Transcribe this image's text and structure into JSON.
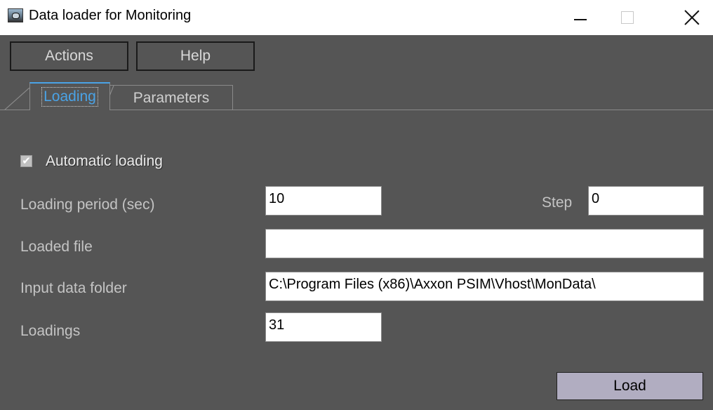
{
  "window": {
    "title": "Data loader for Monitoring",
    "icon": "monitor-app-icon"
  },
  "menu": {
    "actions_label": "Actions",
    "help_label": "Help"
  },
  "tabs": [
    {
      "label": "Loading",
      "active": true
    },
    {
      "label": "Parameters",
      "active": false
    }
  ],
  "form": {
    "automatic_loading": {
      "label": "Automatic loading",
      "checked": true
    },
    "loading_period": {
      "label": "Loading period (sec)",
      "value": "10"
    },
    "step": {
      "label": "Step",
      "value": "0"
    },
    "loaded_file": {
      "label": "Loaded file",
      "value": ""
    },
    "input_data_folder": {
      "label": "Input data folder",
      "value": "C:\\Program Files (x86)\\Axxon PSIM\\Vhost\\MonData\\"
    },
    "loadings": {
      "label": "Loadings",
      "value": "31"
    },
    "load_button": "Load"
  },
  "colors": {
    "client_bg": "#555555",
    "active_tab_accent": "#4aa3e6",
    "load_button_bg": "#b1adc1"
  }
}
